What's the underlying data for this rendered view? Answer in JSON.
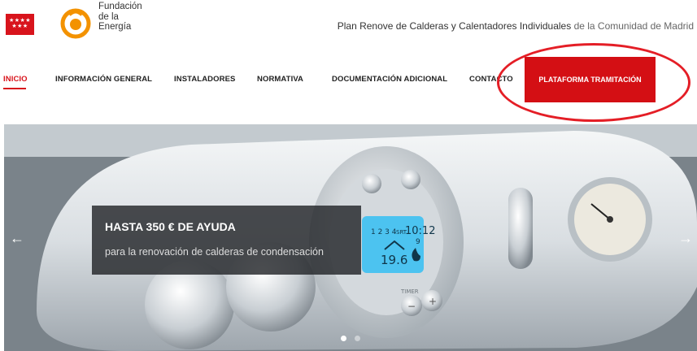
{
  "header": {
    "foundation_line1": "Fundación",
    "foundation_line2": "de la",
    "foundation_line3": "Energía",
    "tagline_main": "Plan Renove de Calderas y Calentadores Individuales",
    "tagline_suffix": " de la Comunidad de Madrid"
  },
  "nav": {
    "items": [
      {
        "label": "INICIO"
      },
      {
        "label": "INFORMACIÓN GENERAL"
      },
      {
        "label": "INSTALADORES"
      },
      {
        "label": "NORMATIVA"
      },
      {
        "label": "DOCUMENTACIÓN ADICIONAL"
      },
      {
        "label": "CONTACTO"
      }
    ],
    "cta_label": "PLATAFORMA TRAMITACIÓN"
  },
  "hero": {
    "title": "HASTA 350 € DE AYUDA",
    "subtitle": "para la renovación de calderas de condensación",
    "prev_icon": "arrow-left-icon",
    "next_icon": "arrow-right-icon",
    "slide_count": 2,
    "active_slide": 1,
    "display": {
      "mode": "1 2 3 4",
      "label": "SRT",
      "time": "10:12",
      "room_temp": "19.6",
      "set_temp": "9",
      "timer": "TIMER",
      "minus": "−",
      "plus": "+"
    }
  },
  "colors": {
    "brand_red": "#d8141c",
    "cta_red": "#d40f14",
    "annotation_red": "#e41e26",
    "logo_orange": "#f39200",
    "display_blue": "#4cc3f0"
  }
}
